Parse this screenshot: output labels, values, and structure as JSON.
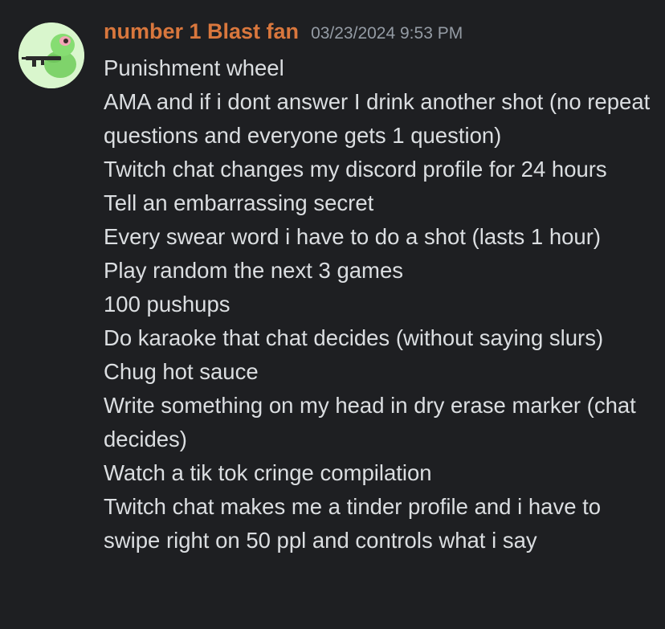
{
  "message": {
    "author": "number 1 Blast fan",
    "timestamp": "03/23/2024 9:53 PM",
    "avatar": "frog-with-rifle-avatar",
    "lines": [
      "Punishment wheel",
      "AMA and if i dont answer I drink another shot (no repeat questions and everyone gets 1 question)",
      "Twitch chat changes my discord profile for 24 hours",
      "Tell an embarrassing secret",
      "Every swear word i have to do a shot (lasts 1 hour)",
      "Play random the next 3 games",
      "100 pushups",
      "Do karaoke that chat decides (without saying slurs)",
      "Chug hot sauce",
      "Write something on my head in dry erase marker (chat decides)",
      "Watch a tik tok cringe compilation",
      "Twitch chat makes me a tinder profile and i have to swipe right on 50 ppl and controls what i say"
    ]
  },
  "colors": {
    "background": "#1e1f22",
    "username": "#d9773d",
    "timestamp": "#949ba4",
    "text": "#dbdee1"
  }
}
